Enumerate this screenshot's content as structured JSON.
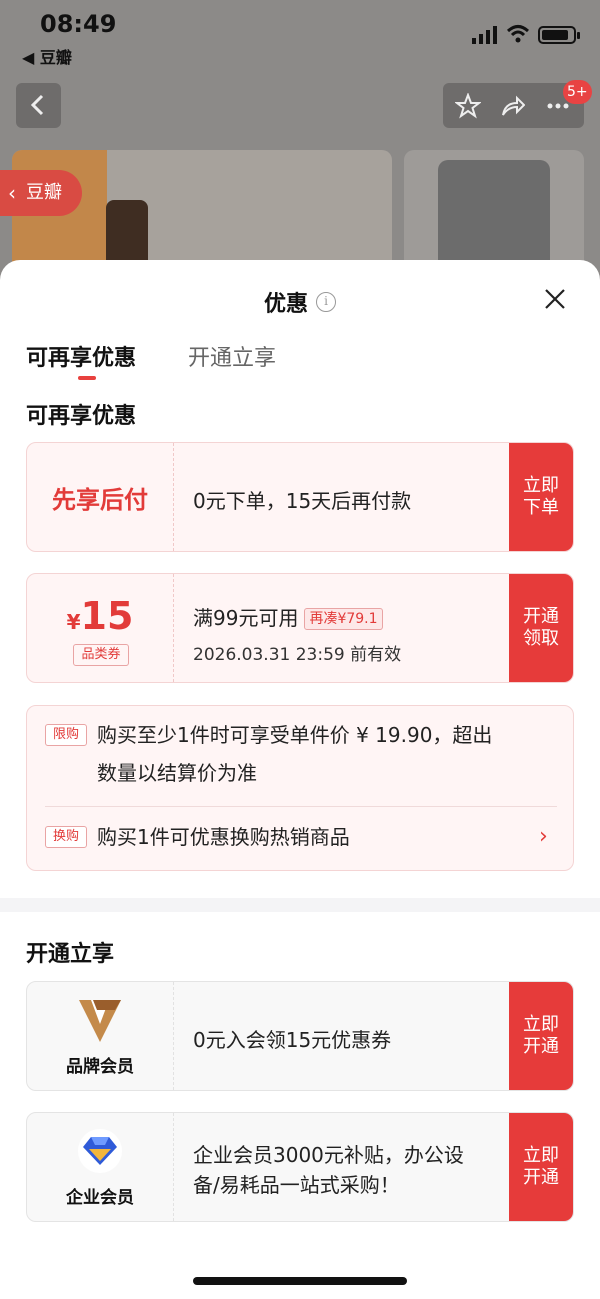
{
  "status_bar": {
    "time": "08:49",
    "back_app": "◀ 豆瓣"
  },
  "nav": {
    "badge": "5+"
  },
  "background": {
    "douban_tag": "豆瓣"
  },
  "sheet": {
    "title": "优惠",
    "info_icon": "i",
    "tabs": [
      {
        "label": "可再享优惠",
        "active": true
      },
      {
        "label": "开通立享",
        "active": false
      }
    ],
    "section1_title": "可再享优惠",
    "pay_later": {
      "left_label": "先享后付",
      "text": "0元下单，15天后再付款",
      "cta": "立即下单"
    },
    "coupon": {
      "currency": "¥",
      "amount": "15",
      "category": "品类券",
      "condition": "满99元可用",
      "tag": "再凑¥79.1",
      "expiry": "2026.03.31 23:59 前有效",
      "cta": "开通领取"
    },
    "promos": [
      {
        "tag": "限购",
        "line1": "购买至少1件时可享受单件价 ¥ 19.90，超出",
        "line2": "数量以结算价为准"
      },
      {
        "tag": "换购",
        "line1": "购买1件可优惠换购热销商品"
      }
    ],
    "section2_title": "开通立享",
    "brand_member": {
      "label": "品牌会员",
      "text": "0元入会领15元优惠券",
      "cta": "立即开通"
    },
    "enterprise_member": {
      "label": "企业会员",
      "line1": "企业会员3000元补贴，办公设",
      "line2": "备/易耗品一站式采购！",
      "cta": "立即开通"
    }
  },
  "colors": {
    "accent": "#e63b3a",
    "accent_text": "#e23b39",
    "card_bg": "#fff5f5",
    "gray_card_bg": "#f8f8f8"
  }
}
